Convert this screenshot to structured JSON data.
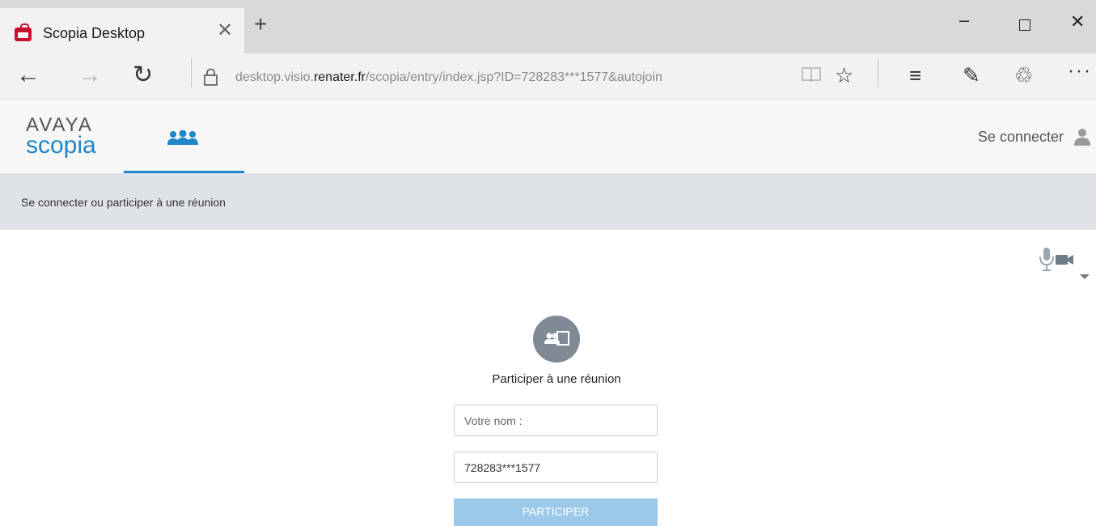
{
  "browser": {
    "tab_title": "Scopia Desktop",
    "tab_close": "✕",
    "new_tab": "+",
    "window": {
      "minimize": "–",
      "close": "✕"
    },
    "url_prefix": "desktop.visio.",
    "url_host": "renater.fr",
    "url_suffix": "/scopia/entry/index.jsp?ID=728283***1577&autojoin",
    "icons": {
      "back": "←",
      "forward": "→",
      "refresh": "↻",
      "reading": "📖",
      "favorite": "☆",
      "hub": "≡",
      "note": "✎",
      "share": "♲",
      "more": "···"
    }
  },
  "app": {
    "brand_top": "AVAYA",
    "brand_bottom": "scopia",
    "login_label": "Se connecter",
    "accent_color": "#1f86c8",
    "subheader": "Se connecter ou participer à une réunion"
  },
  "join_form": {
    "title": "Participer à une réunion",
    "name_placeholder": "Votre nom :",
    "name_value": "",
    "meeting_id_value": "728283***1577",
    "submit_label": "PARTICIPER"
  }
}
